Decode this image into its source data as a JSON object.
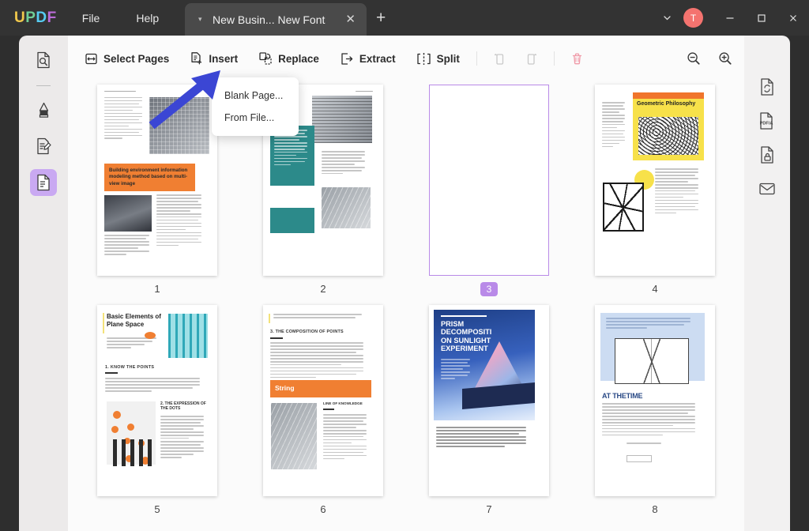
{
  "app": {
    "logo": "UPDF",
    "logo_colors": [
      "#f2c94c",
      "#6fcf97",
      "#56ccf2",
      "#bb6bd9"
    ]
  },
  "titlebar": {
    "menus": [
      {
        "label": "File",
        "name": "menu-file"
      },
      {
        "label": "Help",
        "name": "menu-help"
      }
    ],
    "tab": {
      "title": "New Busin... New Font",
      "caret": "▾",
      "close": "✕"
    },
    "new_tab": "+",
    "account_initial": "T",
    "account_color": "#f4736f",
    "window": {
      "chevron": "⌄",
      "minimize": "—",
      "maximize": "□",
      "close": "✕"
    }
  },
  "toolbar": {
    "buttons": [
      {
        "label": "Select Pages",
        "icon": "select-pages-icon"
      },
      {
        "label": "Insert",
        "icon": "insert-page-icon"
      },
      {
        "label": "Replace",
        "icon": "replace-page-icon"
      },
      {
        "label": "Extract",
        "icon": "extract-page-icon"
      },
      {
        "label": "Split",
        "icon": "split-page-icon"
      }
    ],
    "icon_buttons": [
      {
        "name": "rotate-left-icon"
      },
      {
        "name": "rotate-right-icon"
      },
      {
        "name": "delete-page-icon",
        "color": "#f09aa8"
      }
    ],
    "zoom_out": "zoom-out-icon",
    "zoom_in": "zoom-in-icon"
  },
  "insert_menu": {
    "items": [
      {
        "label": "Blank Page..."
      },
      {
        "label": "From File..."
      }
    ]
  },
  "sidebar_left": {
    "items": [
      {
        "name": "search-document-icon",
        "active": false
      },
      {
        "name": "divider",
        "active": false
      },
      {
        "name": "highlighter-icon",
        "active": false
      },
      {
        "name": "annotate-edit-icon",
        "active": false
      },
      {
        "name": "organize-pages-icon",
        "active": true
      }
    ],
    "active_color": "#c9a9f2"
  },
  "sidebar_right": {
    "items": [
      {
        "name": "convert-document-icon"
      },
      {
        "name": "pdfa-icon",
        "label": "PDF/A"
      },
      {
        "name": "protect-document-icon"
      },
      {
        "name": "share-email-icon"
      }
    ]
  },
  "annotation": {
    "arrow": "blue-arrow-pointing-to-insert",
    "color": "#3b46d4"
  },
  "pages": [
    {
      "number": "1",
      "selected": false,
      "title": "Building environment information modeling method based on multi-view image",
      "theme": "orange"
    },
    {
      "number": "2",
      "selected": false,
      "title": "",
      "theme": "teal"
    },
    {
      "number": "3",
      "selected": true,
      "title": "",
      "theme": "blank"
    },
    {
      "number": "4",
      "selected": false,
      "title": "Geometric Philosophy",
      "theme": "yellow"
    },
    {
      "number": "5",
      "selected": false,
      "title": "Basic Elements of Plane Space",
      "subheads": [
        "1. KNOW THE POINTS",
        "2. THE EXPRESSION OF THE DOTS"
      ],
      "theme": "light"
    },
    {
      "number": "6",
      "selected": false,
      "title": "3. THE COMPOSITION OF POINTS",
      "banner": "String",
      "subheads": [
        "LINE OF KNOWLEDGE"
      ],
      "theme": "orange"
    },
    {
      "number": "7",
      "selected": false,
      "title": "PRISM DECOMPOSITI ON SUNLIGHT EXPERIMENT",
      "theme": "blue"
    },
    {
      "number": "8",
      "selected": false,
      "title": "AT THETIME",
      "theme": "lightblue"
    }
  ]
}
